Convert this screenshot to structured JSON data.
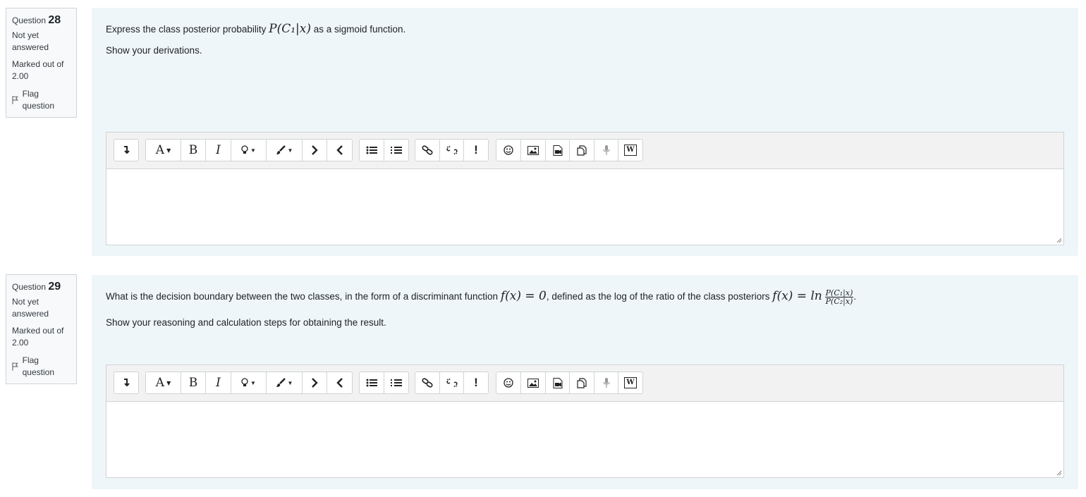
{
  "questions": [
    {
      "label": "Question",
      "number": "28",
      "state_line1": "Not yet",
      "state_line2": "answered",
      "grade_line1": "Marked out of",
      "grade_line2": "2.00",
      "flag": "Flag question",
      "text_prefix": "Express the class posterior probability",
      "text_suffix": "as a sigmoid function.",
      "text_line2": "Show your derivations."
    },
    {
      "label": "Question",
      "number": "29",
      "state_line1": "Not yet",
      "state_line2": "answered",
      "grade_line1": "Marked out of",
      "grade_line2": "2.00",
      "flag": "Flag question",
      "text_prefix": "What is the decision boundary between the two classes, in the form of a discriminant function",
      "text_middle": ", defined as the log of the ratio of the class posteriors",
      "text_suffix": ".",
      "text_line2": "Show your reasoning and calculation steps for obtaining the result."
    }
  ],
  "toolbar": {
    "font_label": "A",
    "bold_label": "B",
    "italic_label": "I",
    "important_label": "!",
    "word_label": "W"
  },
  "math": {
    "posterior_c1": "P(C₁|x)",
    "f_of_x": "f(x) = 0",
    "f_def": "f(x) = ln",
    "frac_num": "P(C₁|x)",
    "frac_den": "P(C₂|x)"
  }
}
